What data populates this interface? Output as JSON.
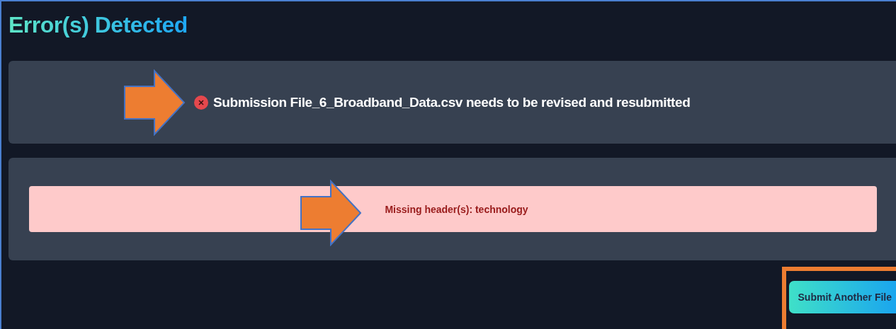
{
  "title": "Error(s) Detected",
  "status": {
    "kind": "error",
    "message": "Submission File_6_Broadband_Data.csv needs to be revised and resubmitted"
  },
  "errors": [
    {
      "message": "Missing header(s): technology"
    }
  ],
  "buttons": [
    {
      "label": "Submit Another File"
    }
  ]
}
